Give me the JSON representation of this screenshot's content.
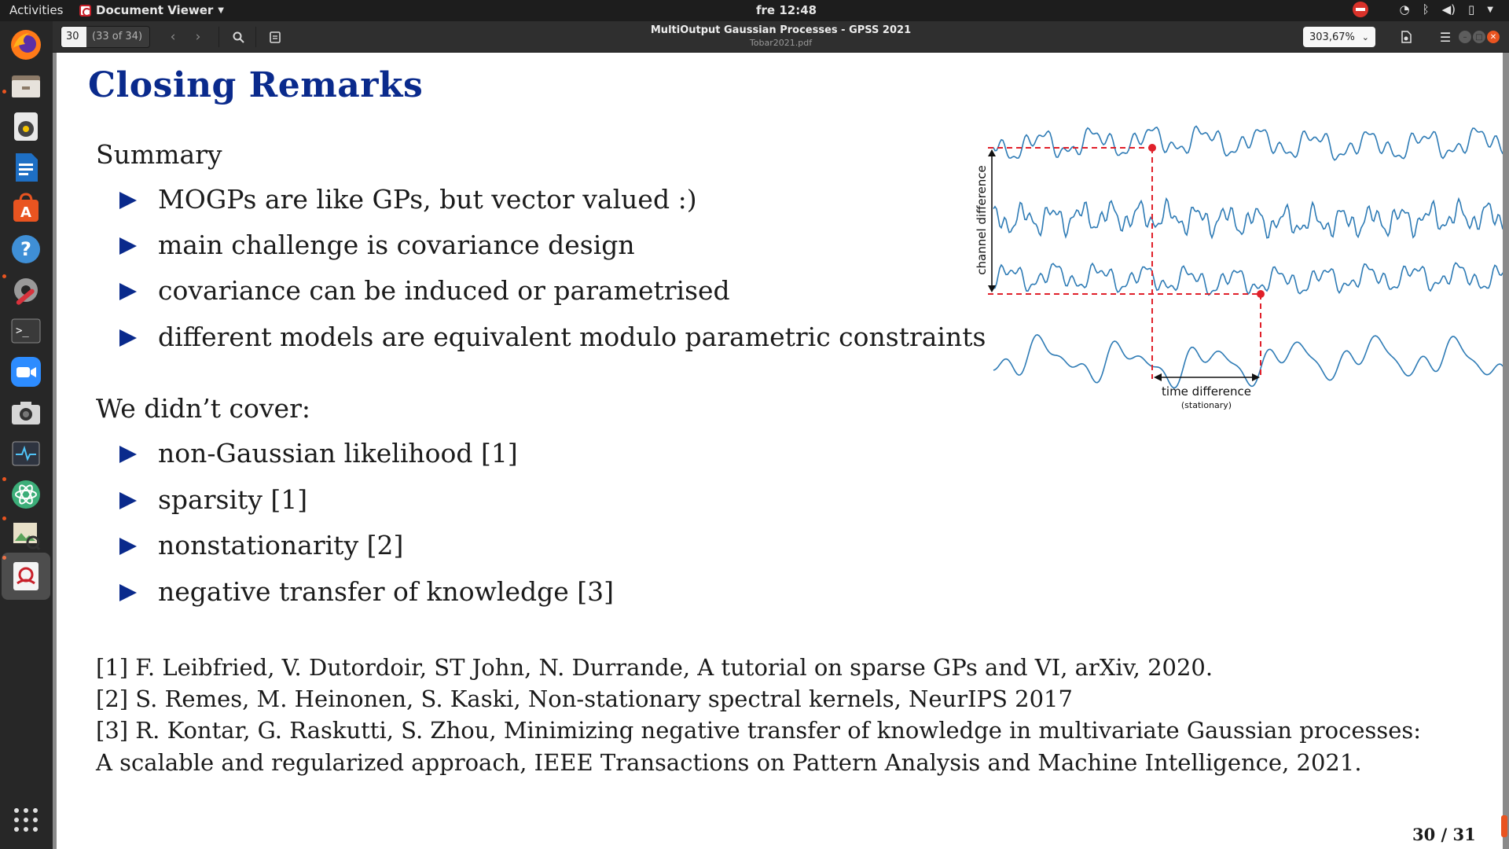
{
  "system": {
    "activities": "Activities",
    "app_name": "Document Viewer",
    "clock": "fre 12:48",
    "tray_icons": [
      "no-entry-icon",
      "wifi-icon",
      "bluetooth-icon",
      "volume-icon",
      "battery-icon",
      "caret-icon"
    ]
  },
  "dock": {
    "items": [
      "firefox-icon",
      "files-icon",
      "rhythmbox-icon",
      "writer-icon",
      "software-center-icon",
      "help-icon",
      "settings-tools-icon",
      "terminal-icon",
      "zoom-icon",
      "camera-icon",
      "system-monitor-icon",
      "atom-icon",
      "image-viewer-icon",
      "document-viewer-icon",
      "show-apps-icon"
    ]
  },
  "viewer": {
    "page_input": "30",
    "page_of": "(33 of 34)",
    "title": "MultiOutput Gaussian Processes - GPSS 2021",
    "filename": "Tobar2021.pdf",
    "zoom": "303,67%"
  },
  "slide": {
    "title": "Closing Remarks",
    "summary_head": "Summary",
    "summary": [
      "MOGPs are like GPs, but vector valued :)",
      "main challenge is covariance design",
      "covariance can be induced or parametrised",
      "different models are equivalent modulo parametric constraints"
    ],
    "notcovered_head": "We didn’t cover:",
    "notcovered": [
      "non-Gaussian likelihood [1]",
      "sparsity [1]",
      "nonstationarity [2]",
      "negative transfer of knowledge [3]"
    ],
    "refs": [
      "[1] F. Leibfried, V. Dutordoir, ST John, N. Durrande, A tutorial on sparse GPs and VI, arXiv, 2020.",
      "[2] S. Remes, M. Heinonen, S. Kaski, Non-stationary spectral kernels, NeurIPS 2017",
      "[3] R. Kontar, G. Raskutti, S. Zhou, Minimizing negative transfer of knowledge in multivariate Gaussian processes:",
      "A scalable and regularized approach, IEEE Transactions on Pattern Analysis and Machine Intelligence, 2021."
    ],
    "page_number": "30 / 31",
    "figure": {
      "channel_label": "channel difference",
      "time_label": "time difference",
      "time_sublabel": "(stationary)",
      "line_color": "#2e7bb5",
      "marker_color": "#e0202a"
    }
  }
}
